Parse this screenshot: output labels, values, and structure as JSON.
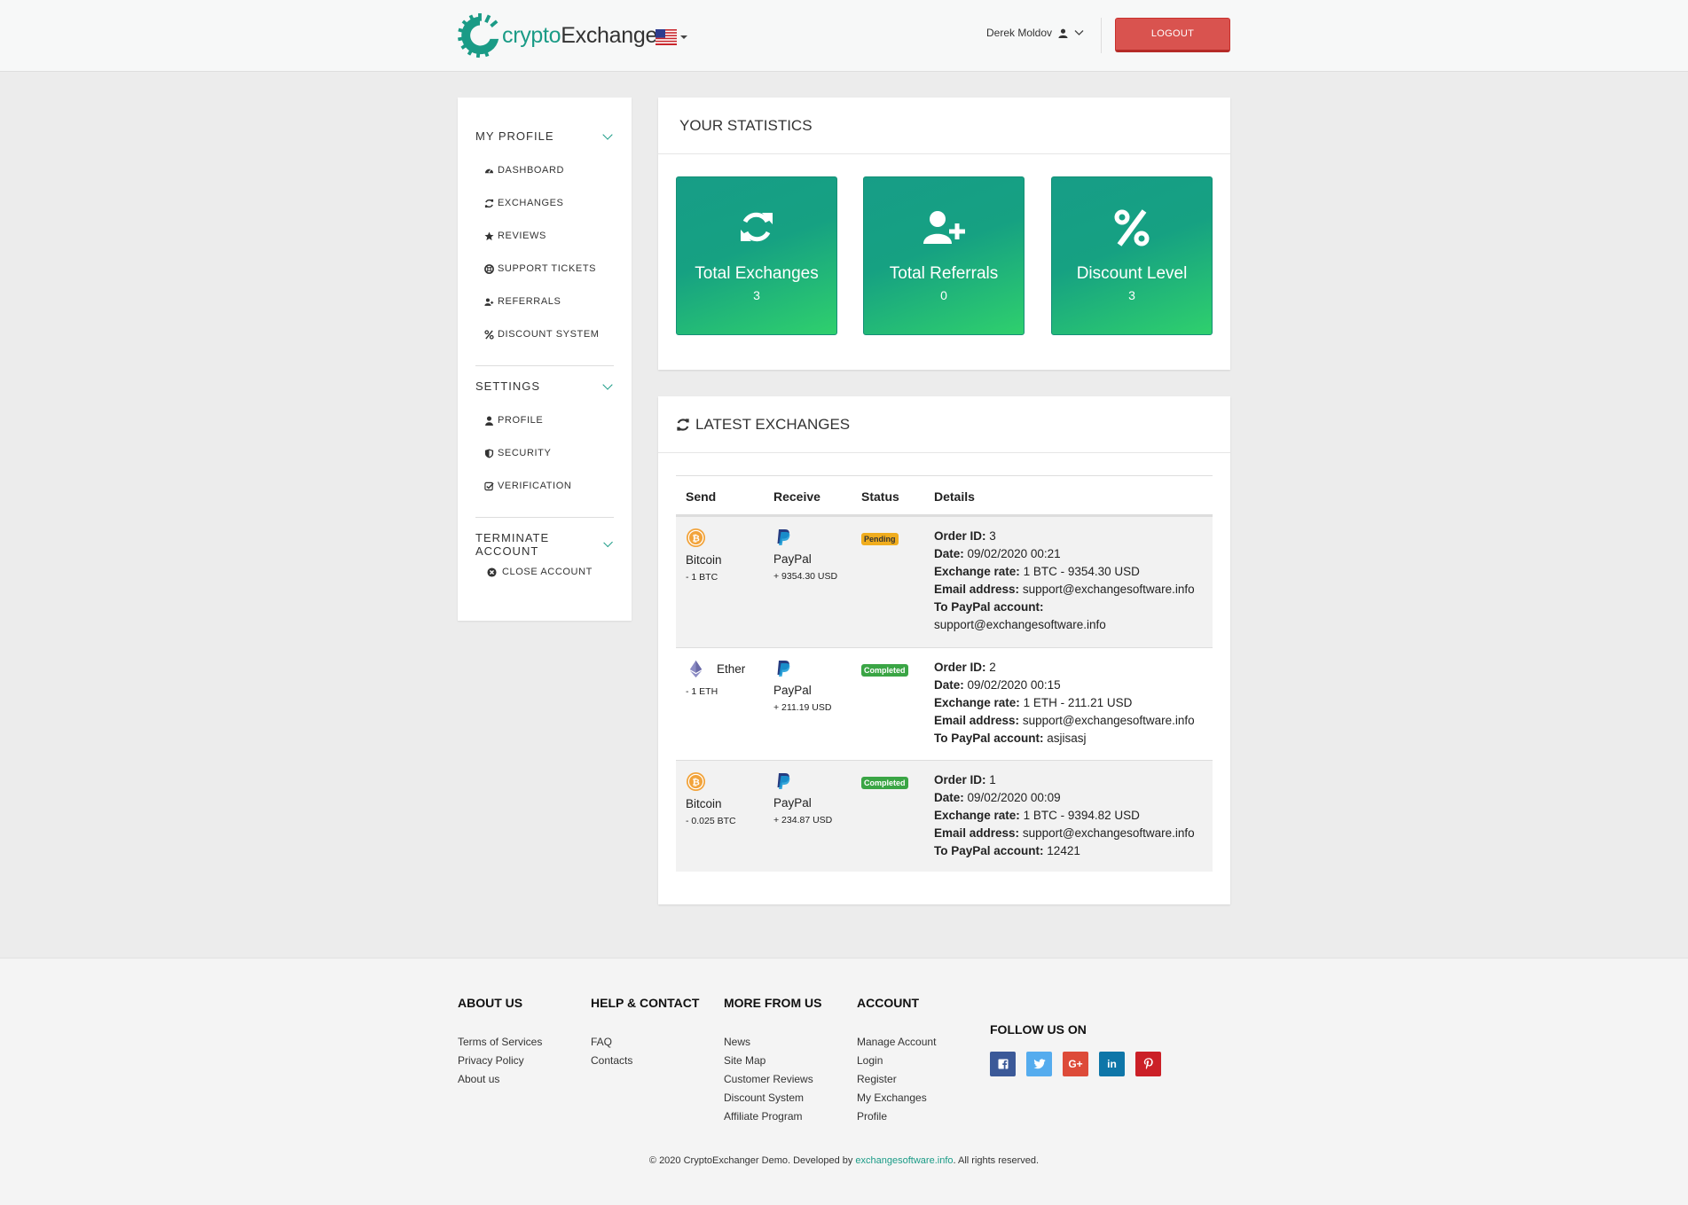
{
  "header": {
    "logo_part1": "crypto",
    "logo_part2": "Exchanger",
    "user_name": "Derek Moldov",
    "logout_label": "LOGOUT"
  },
  "sidebar": {
    "profile_heading": "MY PROFILE",
    "profile_items": [
      "DASHBOARD",
      "EXCHANGES",
      "REVIEWS",
      "SUPPORT TICKETS",
      "REFERRALS",
      "DISCOUNT SYSTEM"
    ],
    "settings_heading": "SETTINGS",
    "settings_items": [
      "PROFILE",
      "SECURITY",
      "VERIFICATION"
    ],
    "terminate_heading": "TERMINATE ACCOUNT",
    "terminate_items": [
      "CLOSE ACCOUNT"
    ]
  },
  "statistics": {
    "title": "YOUR STATISTICS",
    "cards": [
      {
        "label": "Total Exchanges",
        "value": "3",
        "icon": "refresh-icon"
      },
      {
        "label": "Total Referrals",
        "value": "0",
        "icon": "user-plus-icon"
      },
      {
        "label": "Discount Level",
        "value": "3",
        "icon": "percent-icon"
      }
    ]
  },
  "exchanges": {
    "title": "LATEST EXCHANGES",
    "columns": [
      "Send",
      "Receive",
      "Status",
      "Details"
    ],
    "labels": {
      "order_id": "Order ID:",
      "date": "Date:",
      "rate": "Exchange rate:",
      "email": "Email address:",
      "paypal": "To PayPal account:"
    },
    "rows": [
      {
        "send_name": "Bitcoin",
        "send_amount": "- 1 BTC",
        "send_icon": "bitcoin-icon",
        "recv_name": "PayPal",
        "recv_amount": "+ 9354.30 USD",
        "status": "Pending",
        "order_id": "3",
        "date": "09/02/2020 00:21",
        "rate": "1 BTC - 9354.30 USD",
        "email": "support@exchangesoftware.info",
        "paypal": "support@exchangesoftware.info"
      },
      {
        "send_name": "Ether",
        "send_amount": "- 1 ETH",
        "send_icon": "ether-icon",
        "recv_name": "PayPal",
        "recv_amount": "+ 211.19 USD",
        "status": "Completed",
        "order_id": "2",
        "date": "09/02/2020 00:15",
        "rate": "1 ETH - 211.21 USD",
        "email": "support@exchangesoftware.info",
        "paypal": "asjisasj"
      },
      {
        "send_name": "Bitcoin",
        "send_amount": "- 0.025 BTC",
        "send_icon": "bitcoin-icon",
        "recv_name": "PayPal",
        "recv_amount": "+ 234.87 USD",
        "status": "Completed",
        "order_id": "1",
        "date": "09/02/2020 00:09",
        "rate": "1 BTC - 9394.82 USD",
        "email": "support@exchangesoftware.info",
        "paypal": "12421"
      }
    ]
  },
  "footer": {
    "about": {
      "heading": "ABOUT US",
      "links": [
        "Terms of Services",
        "Privacy Policy",
        "About us"
      ]
    },
    "help": {
      "heading": "HELP & CONTACT",
      "links": [
        "FAQ",
        "Contacts"
      ]
    },
    "more": {
      "heading": "MORE FROM US",
      "links": [
        "News",
        "Site Map",
        "Customer Reviews",
        "Discount System",
        "Affiliate Program"
      ]
    },
    "account": {
      "heading": "ACCOUNT",
      "links": [
        "Manage Account",
        "Login",
        "Register",
        "My Exchanges",
        "Profile"
      ]
    },
    "follow_heading": "FOLLOW US ON",
    "socials": [
      {
        "name": "facebook",
        "glyph": "f",
        "color": "#3b5998"
      },
      {
        "name": "twitter",
        "glyph": "t",
        "color": "#55acee"
      },
      {
        "name": "google-plus",
        "glyph": "G+",
        "color": "#dd4b39"
      },
      {
        "name": "linkedin",
        "glyph": "in",
        "color": "#0e76a8"
      },
      {
        "name": "pinterest",
        "glyph": "P",
        "color": "#cb2027"
      }
    ],
    "copyright_pre": "© 2020 CryptoExchanger Demo. Developed by ",
    "copyright_link": "exchangesoftware.info",
    "copyright_post": ". All rights reserved."
  },
  "colors": {
    "accent": "#1a9b86",
    "logout": "#d9534f",
    "pending": "#f0ad1e",
    "completed": "#3aa545"
  }
}
